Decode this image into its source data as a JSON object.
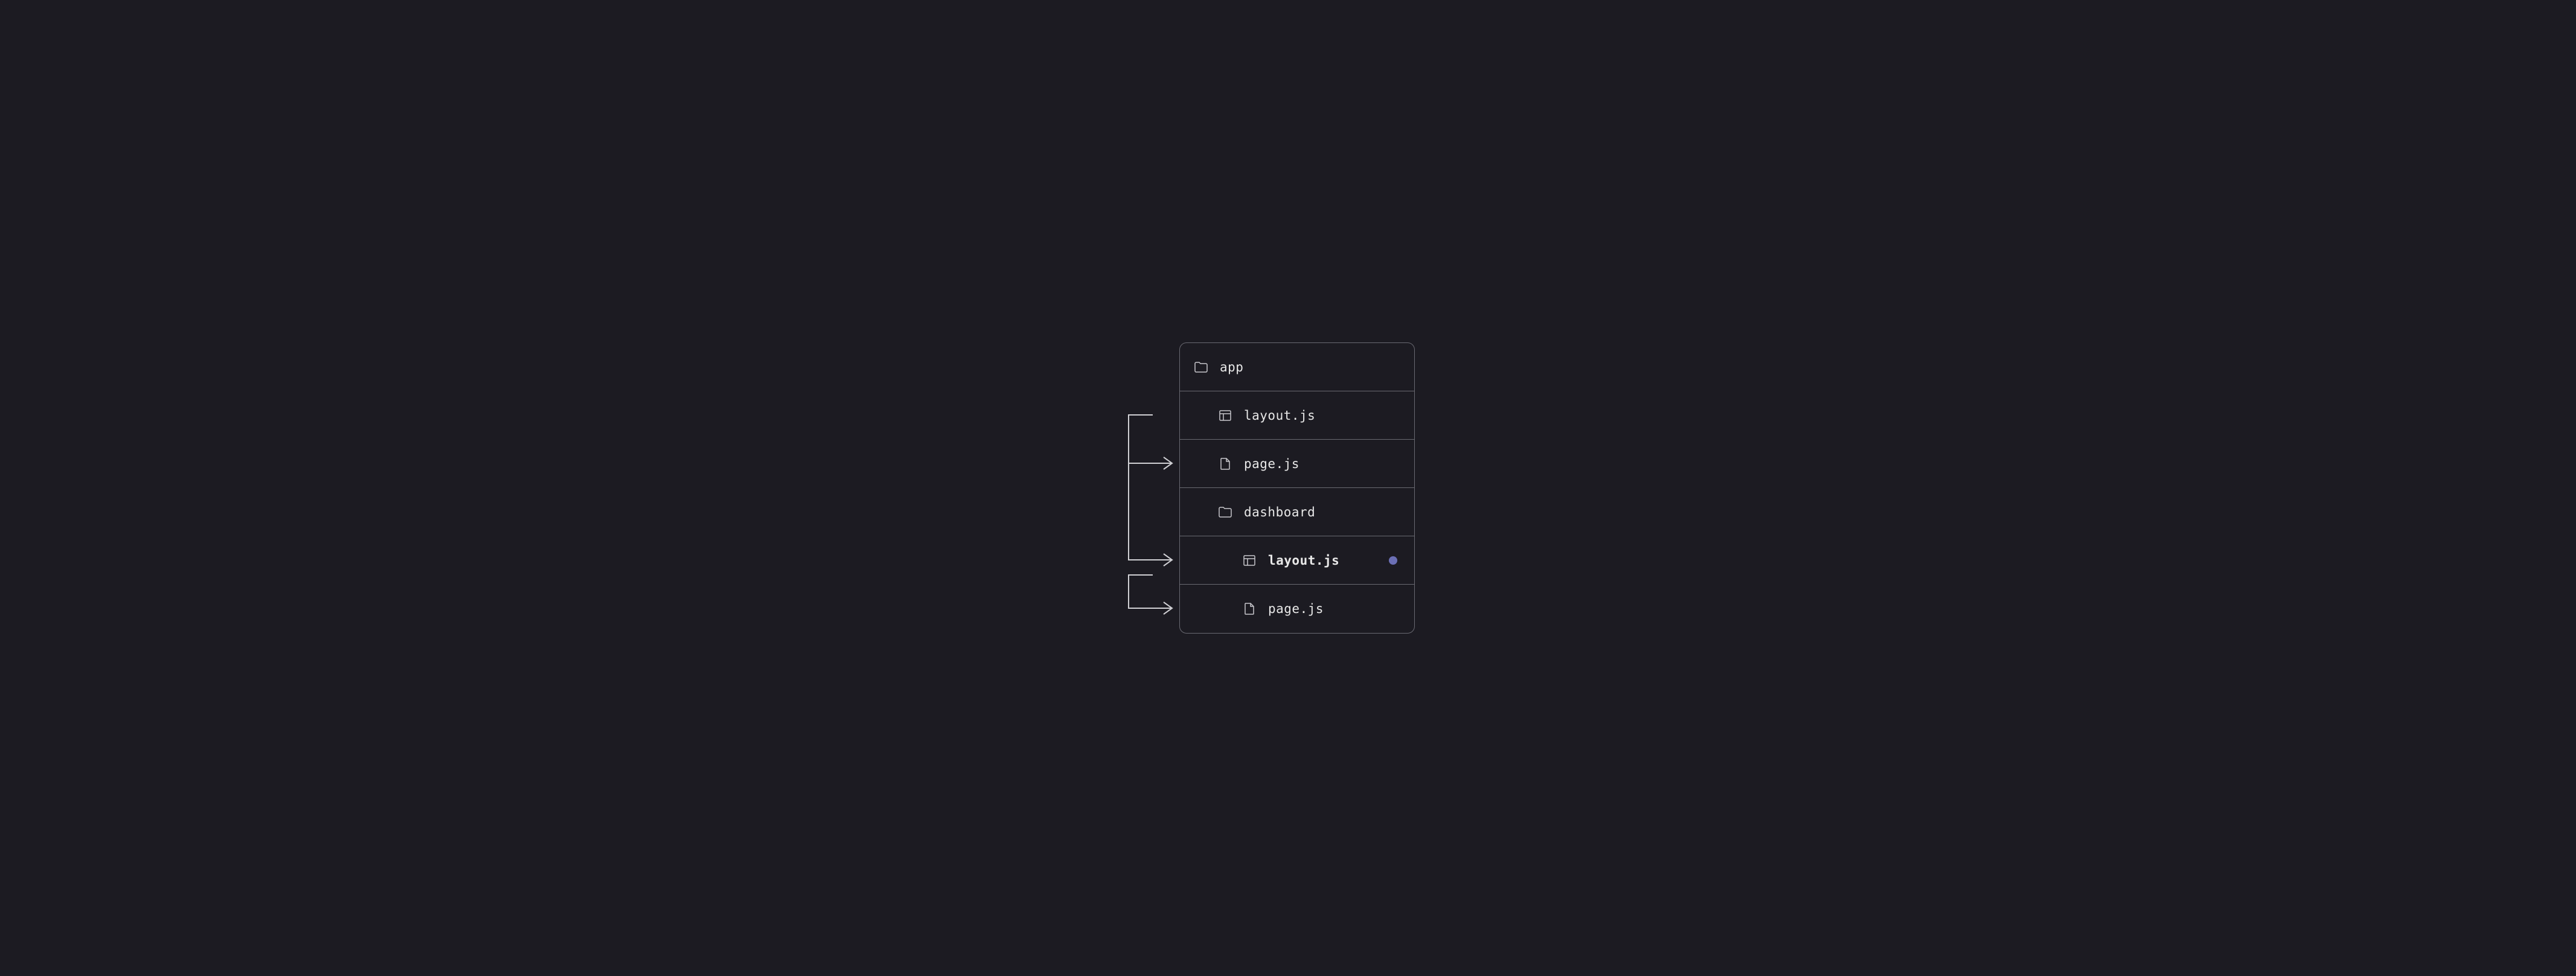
{
  "tree": {
    "root": {
      "label": "app",
      "icon": "folder"
    },
    "items": [
      {
        "label": "layout.js",
        "icon": "layout",
        "depth": 1,
        "bold": false,
        "dot": false
      },
      {
        "label": "page.js",
        "icon": "file",
        "depth": 1,
        "bold": false,
        "dot": false
      },
      {
        "label": "dashboard",
        "icon": "folder",
        "depth": 1,
        "bold": false,
        "dot": false
      },
      {
        "label": "layout.js",
        "icon": "layout",
        "depth": 2,
        "bold": true,
        "dot": true
      },
      {
        "label": "page.js",
        "icon": "file",
        "depth": 2,
        "bold": false,
        "dot": false
      }
    ]
  }
}
